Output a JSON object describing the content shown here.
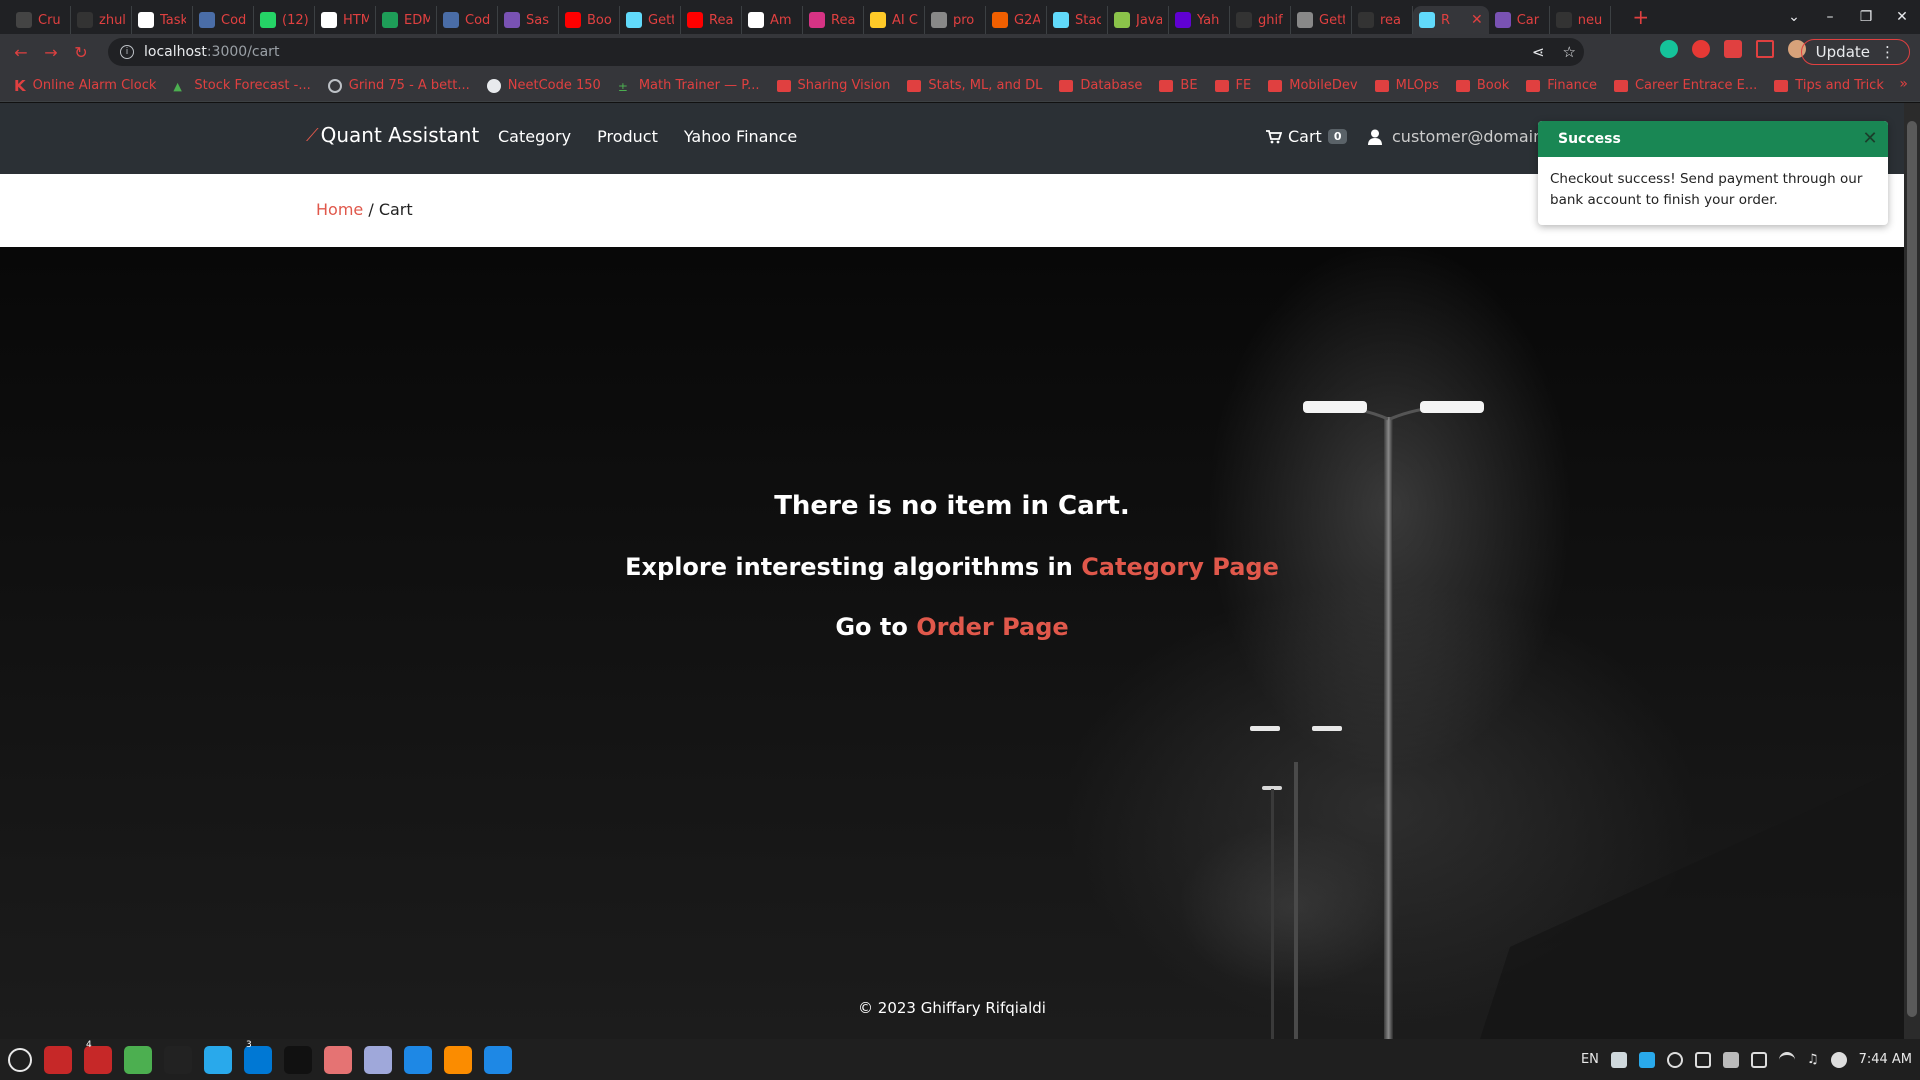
{
  "browser": {
    "tabs": [
      {
        "label": "Cru",
        "icon": "circle-logo-icon",
        "color": "#444"
      },
      {
        "label": "zhul",
        "icon": "github-icon",
        "color": "#333"
      },
      {
        "label": "Task",
        "icon": "notion-icon",
        "color": "#fff"
      },
      {
        "label": "Cod",
        "icon": "doc-icon",
        "color": "#4a6da7"
      },
      {
        "label": "(12)",
        "icon": "whatsapp-icon",
        "color": "#25d366"
      },
      {
        "label": "HTM",
        "icon": "cb-icon",
        "color": "#fff"
      },
      {
        "label": "EDM",
        "icon": "sheets-icon",
        "color": "#1e9e58"
      },
      {
        "label": "Cod",
        "icon": "doc-icon",
        "color": "#4a6da7"
      },
      {
        "label": "Sas",
        "icon": "bootstrap-icon",
        "color": "#7952b3"
      },
      {
        "label": "Boo",
        "icon": "youtube-icon",
        "color": "#ff0000"
      },
      {
        "label": "Gett",
        "icon": "react-icon",
        "color": "#61dafb"
      },
      {
        "label": "Rea",
        "icon": "youtube-icon",
        "color": "#ff0000"
      },
      {
        "label": "Am",
        "icon": "amazon-icon",
        "color": "#fff"
      },
      {
        "label": "Rea",
        "icon": "react-icon",
        "color": "#d63384"
      },
      {
        "label": "AI C",
        "icon": "firebase-icon",
        "color": "#ffca28"
      },
      {
        "label": "pro",
        "icon": "globe-icon",
        "color": "#888"
      },
      {
        "label": "G2A",
        "icon": "g2a-icon",
        "color": "#f05f00"
      },
      {
        "label": "Stac",
        "icon": "react-icon",
        "color": "#61dafb"
      },
      {
        "label": "Java",
        "icon": "play-icon",
        "color": "#8bc34a"
      },
      {
        "label": "Yah",
        "icon": "yahoo-icon",
        "color": "#6001d2"
      },
      {
        "label": "ghif",
        "icon": "github-icon",
        "color": "#333"
      },
      {
        "label": "Gett",
        "icon": "globe-icon",
        "color": "#888"
      },
      {
        "label": "rea",
        "icon": "github-icon",
        "color": "#333"
      },
      {
        "label": "R",
        "icon": "react-icon",
        "color": "#61dafb",
        "active": true
      },
      {
        "label": "Car",
        "icon": "bootstrap-icon",
        "color": "#7952b3"
      },
      {
        "label": "neu",
        "icon": "github-icon",
        "color": "#333"
      }
    ],
    "url_host": "localhost",
    "url_path": ":3000/cart",
    "update_label": "Update",
    "bookmarks": [
      {
        "label": "Online Alarm Clock",
        "icon": "k-icon"
      },
      {
        "label": "Stock Forecast -...",
        "icon": "chart-icon"
      },
      {
        "label": "Grind 75 - A bett...",
        "icon": "globe-icon"
      },
      {
        "label": "NeetCode 150",
        "icon": "github-icon"
      },
      {
        "label": "Math Trainer — P...",
        "icon": "math-icon"
      },
      {
        "label": "Sharing Vision",
        "icon": "folder-icon"
      },
      {
        "label": "Stats, ML, and DL",
        "icon": "folder-icon"
      },
      {
        "label": "Database",
        "icon": "folder-icon"
      },
      {
        "label": "BE",
        "icon": "folder-icon"
      },
      {
        "label": "FE",
        "icon": "folder-icon"
      },
      {
        "label": "MobileDev",
        "icon": "folder-icon"
      },
      {
        "label": "MLOps",
        "icon": "folder-icon"
      },
      {
        "label": "Book",
        "icon": "folder-icon"
      },
      {
        "label": "Finance",
        "icon": "folder-icon"
      },
      {
        "label": "Career Entrace E...",
        "icon": "folder-icon"
      },
      {
        "label": "Tips and Trick",
        "icon": "folder-icon"
      }
    ]
  },
  "site": {
    "brand": "Quant Assistant",
    "nav": [
      "Category",
      "Product",
      "Yahoo Finance"
    ],
    "cart_label": "Cart",
    "cart_count": "0",
    "user_email": "customer@domain.c",
    "breadcrumb_home": "Home",
    "breadcrumb_sep": " / ",
    "breadcrumb_current": "Cart",
    "empty_title": "There is no item in Cart.",
    "explore_text": "Explore interesting algorithms in ",
    "explore_link": "Category Page",
    "order_text": "Go to ",
    "order_link": "Order Page",
    "footer": "© 2023 Ghiffary Rifqialdi"
  },
  "toast": {
    "title": "Success",
    "message": "Checkout success! Send payment through our bank account to finish your order."
  },
  "taskbar": {
    "apps": [
      {
        "name": "launcher-icon",
        "color": "transparent"
      },
      {
        "name": "folder-app-icon",
        "color": "#c62828"
      },
      {
        "name": "files-app-icon",
        "color": "#c62828",
        "badge": "4"
      },
      {
        "name": "chrome-icon",
        "color": "#4caf50"
      },
      {
        "name": "terminal-icon",
        "color": "#222"
      },
      {
        "name": "telegram-icon",
        "color": "#29a9eb"
      },
      {
        "name": "vscode-icon",
        "color": "#0078d4",
        "badge": "3"
      },
      {
        "name": "intellij-icon",
        "color": "#111"
      },
      {
        "name": "image-viewer-icon",
        "color": "#e57373"
      },
      {
        "name": "text-editor-icon",
        "color": "#9fa8da"
      },
      {
        "name": "dolphin-icon",
        "color": "#1e88e5"
      },
      {
        "name": "pen-app-icon",
        "color": "#fb8c00"
      },
      {
        "name": "docker-icon",
        "color": "#1e88e5"
      }
    ],
    "lang": "EN",
    "time": "7:44 AM"
  }
}
